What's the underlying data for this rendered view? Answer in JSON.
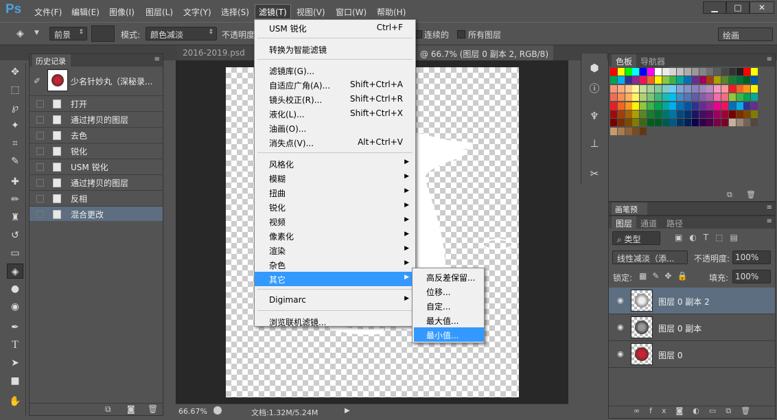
{
  "app": {
    "logo": "Ps"
  },
  "menubar": {
    "items": [
      "文件(F)",
      "编辑(E)",
      "图像(I)",
      "图层(L)",
      "文字(Y)",
      "选择(S)",
      "滤镜(T)",
      "视图(V)",
      "窗口(W)",
      "帮助(H)"
    ],
    "active": "滤镜(T)"
  },
  "window_controls": {
    "minimize": "▁",
    "maximize": "□",
    "close": "✕"
  },
  "options": {
    "fill_source": "前景",
    "mode_label": "模式:",
    "mode_value": "颜色减淡",
    "opacity_label": "不透明度",
    "contiguous_label": "连续的",
    "all_layers_label": "所有图层",
    "workspace": "绘画"
  },
  "tabs": {
    "doc1": "2016-2019.psd",
    "doc2": "@ 66.7% (图层 0 副本 2, RGB/8) *"
  },
  "history": {
    "title": "历史记录",
    "snapshot": "少名针妙丸（深秘录...",
    "items": [
      "打开",
      "通过拷贝的图层",
      "去色",
      "锐化",
      "USM 锐化",
      "通过拷贝的图层",
      "反相",
      "混合更改"
    ],
    "selected_index": 7
  },
  "filter_menu": {
    "items": [
      {
        "label": "USM 锐化",
        "shortcut": "Ctrl+F"
      },
      {
        "sep": true
      },
      {
        "label": "转换为智能滤镜"
      },
      {
        "sep": true
      },
      {
        "label": "滤镜库(G)..."
      },
      {
        "label": "自适应广角(A)...",
        "shortcut": "Shift+Ctrl+A"
      },
      {
        "label": "镜头校正(R)...",
        "shortcut": "Shift+Ctrl+R"
      },
      {
        "label": "液化(L)...",
        "shortcut": "Shift+Ctrl+X"
      },
      {
        "label": "油画(O)..."
      },
      {
        "label": "消失点(V)...",
        "shortcut": "Alt+Ctrl+V"
      },
      {
        "sep": true
      },
      {
        "label": "风格化",
        "sub": true
      },
      {
        "label": "模糊",
        "sub": true
      },
      {
        "label": "扭曲",
        "sub": true
      },
      {
        "label": "锐化",
        "sub": true
      },
      {
        "label": "视频",
        "sub": true
      },
      {
        "label": "像素化",
        "sub": true
      },
      {
        "label": "渲染",
        "sub": true
      },
      {
        "label": "杂色",
        "sub": true
      },
      {
        "label": "其它",
        "sub": true,
        "selected": true
      },
      {
        "sep": true
      },
      {
        "label": "Digimarc",
        "sub": true
      },
      {
        "sep": true
      },
      {
        "label": "浏览联机滤镜..."
      }
    ]
  },
  "other_submenu": {
    "items": [
      "高反差保留...",
      "位移...",
      "自定...",
      "最大值...",
      "最小值..."
    ],
    "selected_index": 4
  },
  "status": {
    "zoom": "66.67%",
    "doc_info": "文档:1.32M/5.24M"
  },
  "swatches_panel": {
    "tabs": [
      "色板",
      "导航器"
    ]
  },
  "swatch_colors": [
    [
      "#ff0000",
      "#ffff00",
      "#00ff00",
      "#00ffff",
      "#0000ff",
      "#ff00ff",
      "#ffffff",
      "#ebebeb",
      "#d6d6d6",
      "#c2c2c2",
      "#adadad",
      "#999999",
      "#858585",
      "#707070",
      "#5c5c5c",
      "#474747",
      "#333333",
      "#1f1f1f",
      "#ff0000",
      "#ffff00"
    ],
    [
      "#00a651",
      "#00aeef",
      "#2e3192",
      "#92278f",
      "#ed145b",
      "#f26522",
      "#fff200",
      "#8dc63f",
      "#39b54a",
      "#00a99d",
      "#0072bc",
      "#662d91",
      "#9e005d",
      "#a0410d",
      "#aba000",
      "#598527",
      "#197b30",
      "#007236",
      "#005e20",
      "#0054a6"
    ],
    [
      "#f7977a",
      "#f9ad81",
      "#fdc68a",
      "#fff79a",
      "#c4df9b",
      "#a3d39c",
      "#82ca9d",
      "#7bcdc8",
      "#6ecff6",
      "#7ea7d8",
      "#8493ca",
      "#8882be",
      "#a187be",
      "#bc8dbf",
      "#f49ac2",
      "#f6989d",
      "#ed1c24",
      "#f26522",
      "#f7941d",
      "#fff200"
    ],
    [
      "#f26c4f",
      "#f68e55",
      "#fbaf5c",
      "#fff467",
      "#acd372",
      "#7cc576",
      "#3bb878",
      "#1abbb4",
      "#00bff3",
      "#438cca",
      "#5574b9",
      "#605ca8",
      "#855fa8",
      "#a763a8",
      "#f06ea9",
      "#f26d7d",
      "#8dc63f",
      "#39b54a",
      "#00a651",
      "#00a99d"
    ],
    [
      "#ed1c24",
      "#f26522",
      "#f7941d",
      "#fff200",
      "#8dc63f",
      "#39b54a",
      "#00a651",
      "#00a99d",
      "#00aeef",
      "#0072bc",
      "#0054a6",
      "#2e3192",
      "#662d91",
      "#92278f",
      "#ec008c",
      "#ed145b",
      "#0072bc",
      "#00aeef",
      "#2e3192",
      "#662d91"
    ],
    [
      "#9e0b0f",
      "#a0410d",
      "#a36209",
      "#aba000",
      "#598527",
      "#197b30",
      "#007236",
      "#00746b",
      "#0076a3",
      "#004a80",
      "#003471",
      "#1b1464",
      "#440e62",
      "#630460",
      "#9e005d",
      "#9e0039",
      "#790000",
      "#7b2e00",
      "#7d4900",
      "#827b00"
    ],
    [
      "#790000",
      "#7b2e00",
      "#7d4900",
      "#827b00",
      "#406618",
      "#005e20",
      "#005826",
      "#005952",
      "#005b7f",
      "#003663",
      "#002157",
      "#0d004c",
      "#32004b",
      "#4b0049",
      "#7b0046",
      "#7a0026",
      "#c7b299",
      "#998675",
      "#736357",
      "#534741"
    ],
    [
      "#c69c6d",
      "#a67c52",
      "#8c6239",
      "#754c24",
      "#603913"
    ]
  ],
  "brush_panel": {
    "title": "画笔预设"
  },
  "layers_panel": {
    "tabs": [
      "图层",
      "通道",
      "路径"
    ],
    "filter_kind": "类型",
    "blend_mode": "线性减淡（添...",
    "opacity_label": "不透明度:",
    "opacity_value": "100%",
    "lock_label": "锁定:",
    "fill_label": "填充:",
    "fill_value": "100%",
    "layers": [
      {
        "name": "图层 0 副本 2",
        "selected": true
      },
      {
        "name": "图层 0 副本"
      },
      {
        "name": "图层 0"
      }
    ]
  }
}
